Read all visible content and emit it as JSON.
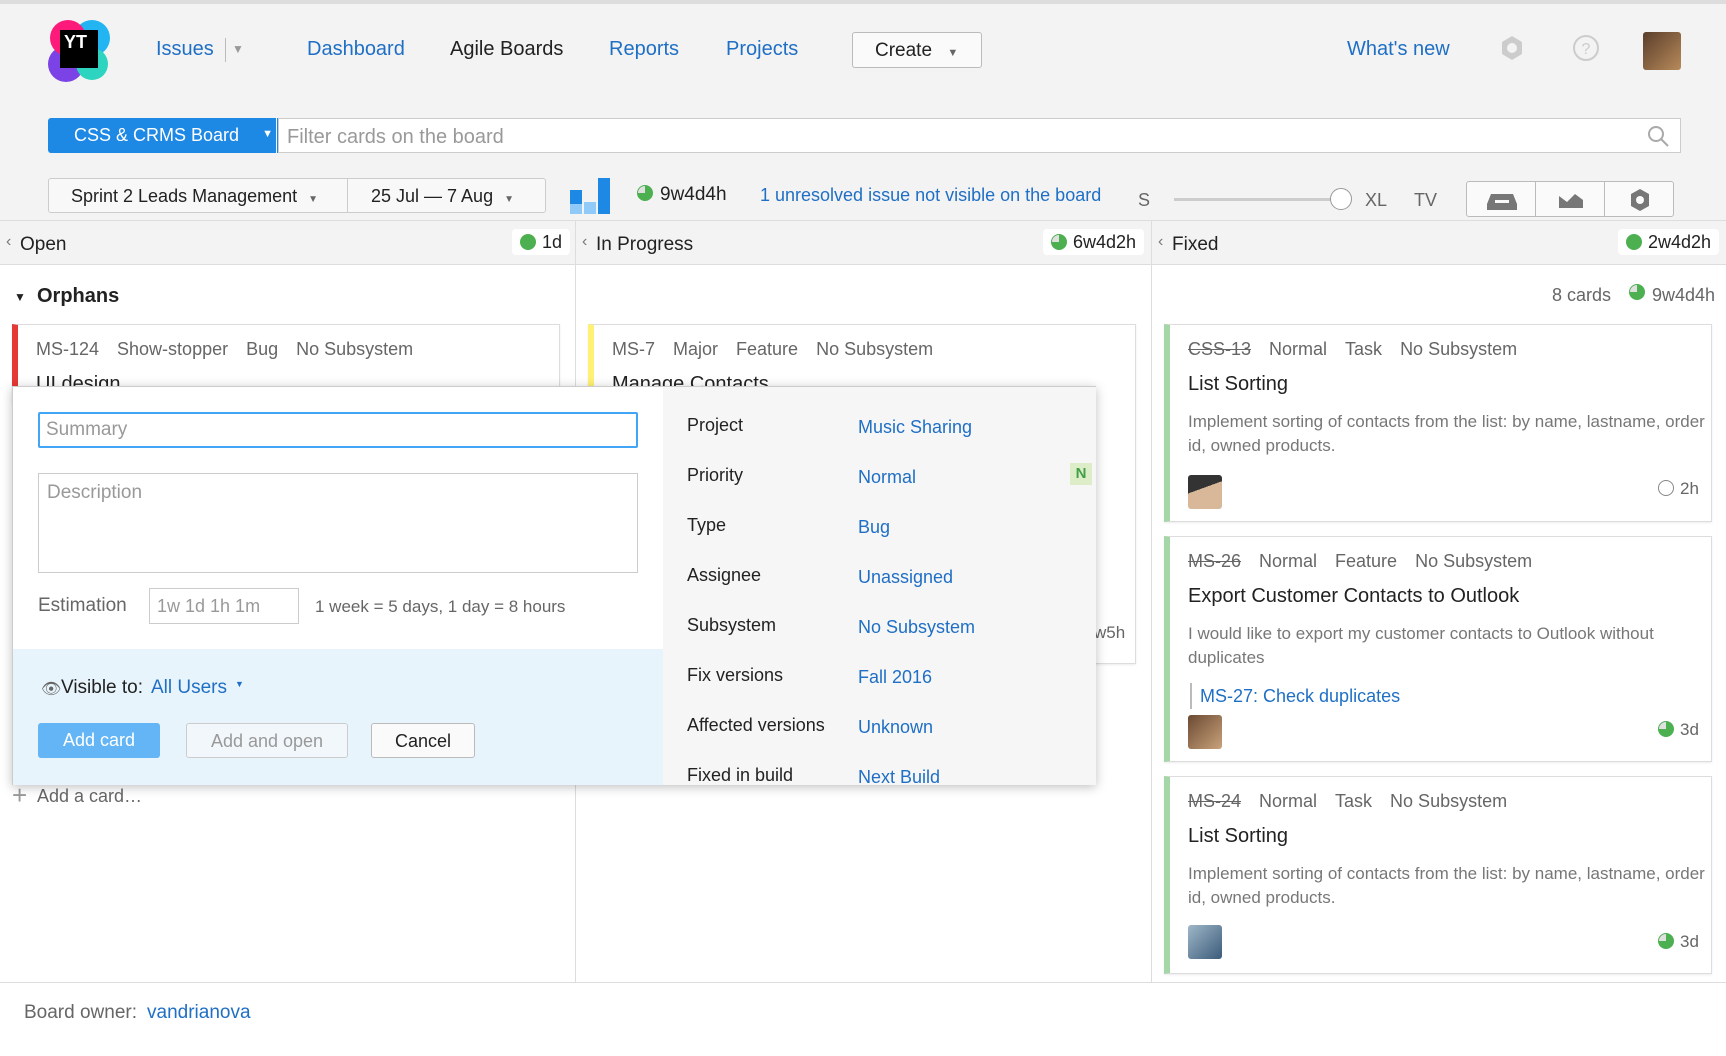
{
  "colors": {
    "accent": "#1e88e5",
    "link": "#1f6fc5",
    "showstopper": "#e53935",
    "major": "#fff176",
    "normal": "#a5d6a7"
  },
  "nav": {
    "logo_text": "YT",
    "issues": "Issues",
    "dashboard": "Dashboard",
    "agile_boards": "Agile Boards",
    "reports": "Reports",
    "projects": "Projects",
    "create": "Create",
    "whats_new": "What's new"
  },
  "toolbar": {
    "board_name": "CSS & CRMS Board",
    "filter_placeholder": "Filter cards on the board",
    "sprint": "Sprint 2 Leads Management",
    "dates": "25 Jul — 7 Aug",
    "total_estimate": "9w4d4h",
    "unresolved_link": "1 unresolved issue not visible on the board",
    "size_s": "S",
    "size_xl": "XL",
    "size_tv": "TV"
  },
  "columns": [
    {
      "name": "Open",
      "estimate": "1d"
    },
    {
      "name": "In Progress",
      "estimate": "6w4d2h"
    },
    {
      "name": "Fixed",
      "estimate": "2w4d2h"
    }
  ],
  "swimlane": {
    "name": "Orphans",
    "count": "8 cards",
    "estimate": "9w4d4h"
  },
  "cards": {
    "open1": {
      "id": "MS-124",
      "priority": "Show-stopper",
      "type": "Bug",
      "subsystem": "No Subsystem",
      "title": "UI design"
    },
    "prog1": {
      "id": "MS-7",
      "priority": "Major",
      "type": "Feature",
      "subsystem": "No Subsystem",
      "title": "Manage Contacts",
      "estimate": "w5h"
    },
    "fixed1": {
      "id": "CSS-13",
      "priority": "Normal",
      "type": "Task",
      "subsystem": "No Subsystem",
      "title": "List Sorting",
      "desc": "Implement sorting of contacts from the list: by name, lastname, order id, owned products.",
      "estimate": "2h"
    },
    "fixed2": {
      "id": "MS-26",
      "priority": "Normal",
      "type": "Feature",
      "subsystem": "No Subsystem",
      "title": "Export Customer Contacts to Outlook",
      "desc": "I would like to export my customer contacts to Outlook without duplicates",
      "link": "MS-27: Check duplicates",
      "estimate": "3d"
    },
    "fixed3": {
      "id": "MS-24",
      "priority": "Normal",
      "type": "Task",
      "subsystem": "No Subsystem",
      "title": "List Sorting",
      "desc": "Implement sorting of contacts from the list: by name, lastname, order id, owned products.",
      "estimate": "3d"
    }
  },
  "popup": {
    "summary_placeholder": "Summary",
    "description_placeholder": "Description",
    "estimation_label": "Estimation",
    "estimation_placeholder": "1w 1d 1h 1m",
    "estimation_hint": "1 week = 5 days, 1 day = 8 hours",
    "visible_to_label": "Visible to:",
    "visible_to_value": "All Users",
    "add_card": "Add card",
    "add_and_open": "Add and open",
    "cancel": "Cancel",
    "priority_badge": "N",
    "fields": [
      {
        "label": "Project",
        "value": "Music Sharing"
      },
      {
        "label": "Priority",
        "value": "Normal"
      },
      {
        "label": "Type",
        "value": "Bug"
      },
      {
        "label": "Assignee",
        "value": "Unassigned"
      },
      {
        "label": "Subsystem",
        "value": "No Subsystem"
      },
      {
        "label": "Fix versions",
        "value": "Fall 2016"
      },
      {
        "label": "Affected versions",
        "value": "Unknown"
      },
      {
        "label": "Fixed in build",
        "value": "Next Build"
      }
    ]
  },
  "add_card_link": "Add a card…",
  "footer": {
    "owner_label": "Board owner:",
    "owner": "vandrianova"
  }
}
